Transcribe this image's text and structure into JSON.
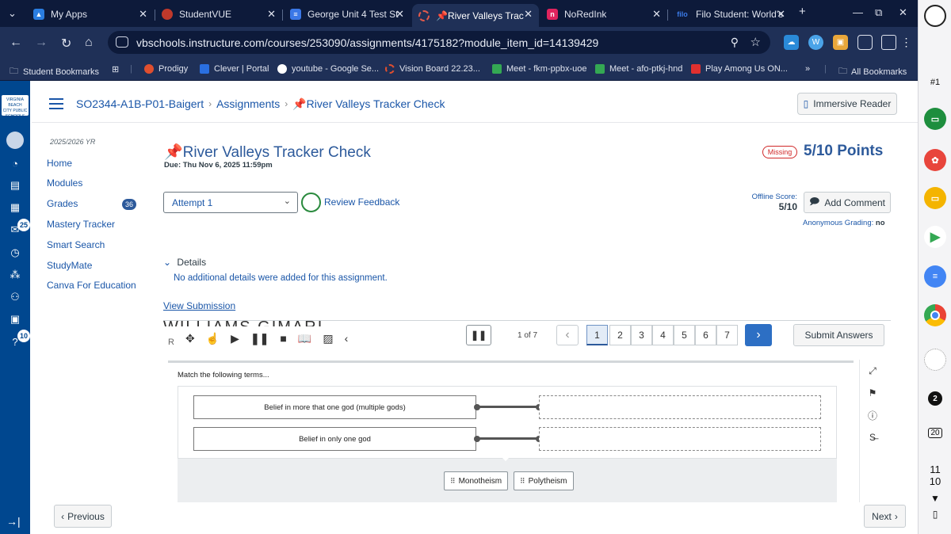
{
  "browser": {
    "tabs": [
      {
        "label": "My Apps",
        "fav_color": "#2a7de1"
      },
      {
        "label": "StudentVUE",
        "fav_color": "#c0392b"
      },
      {
        "label": "George Unit 4 Test St",
        "fav_color": "#3b78e7"
      },
      {
        "label": "📌River Valleys Trac",
        "fav_color": "#d44"
      },
      {
        "label": "NoRedInk",
        "fav_color": "#e0245e"
      },
      {
        "label": "Filo Student: World's",
        "fav_color": "#2f6fe0"
      }
    ],
    "new_tab": "+",
    "close": "✕",
    "url": "vbschools.instructure.com/courses/253090/assignments/4175182?module_item_id=14139429",
    "bookmarks": [
      {
        "label": "Student Bookmarks",
        "color": "#dfe3ee"
      },
      {
        "label": "Prodigy",
        "color": "#e04f2f"
      },
      {
        "label": "Clever | Portal",
        "color": "#2a6fe0"
      },
      {
        "label": "youtube - Google Se...",
        "color": "#ffffff"
      },
      {
        "label": "Vision Board 22.23...",
        "color": "#e04f2f"
      },
      {
        "label": "Meet - fkm-ppbx-uoe",
        "color": "#34a853"
      },
      {
        "label": "Meet - afo-ptkj-hnd",
        "color": "#34a853"
      },
      {
        "label": "Play Among Us ON...",
        "color": "#e0302f"
      },
      {
        "label": "»",
        "color": "#dfe3ee"
      },
      {
        "label": "All Bookmarks",
        "color": "#dfe3ee"
      }
    ]
  },
  "shelf": {
    "apps": [
      {
        "name": "chrome-icon",
        "color": "#4285f4"
      },
      {
        "name": "classroom-icon",
        "color": "#1e8e3e"
      },
      {
        "name": "art-icon",
        "color": "#e8453c"
      },
      {
        "name": "slides-icon",
        "color": "#f4b400"
      },
      {
        "name": "play-store-icon",
        "color": "#34a853"
      },
      {
        "name": "docs-icon",
        "color": "#4285f4"
      }
    ],
    "badge1": "#1",
    "notif_count": "2",
    "calendar_day": "20",
    "time_hour": "11",
    "time_min": "10"
  },
  "canvas": {
    "breadcrumb": {
      "course": "SO2344-A1B-P01-Baigert",
      "section": "Assignments",
      "current": "📌River Valleys Tracker Check"
    },
    "immersive_reader": "Immersive Reader",
    "term": "2025/2026 YR",
    "nav": [
      {
        "label": "Home"
      },
      {
        "label": "Modules"
      },
      {
        "label": "Grades",
        "count": "36"
      },
      {
        "label": "Mastery Tracker"
      },
      {
        "label": "Smart Search"
      },
      {
        "label": "StudyMate"
      },
      {
        "label": "Canva For Education"
      }
    ],
    "rail_badges": {
      "inbox": "25",
      "history": "10"
    }
  },
  "assignment": {
    "title": "📌River Valleys Tracker Check",
    "due": "Due: Thu Nov 6, 2025 11:59pm",
    "status": "Missing",
    "points": "5/10 Points",
    "attempt": "Attempt 1",
    "review_feedback": "Review Feedback",
    "offline_label": "Offline Score:",
    "offline_score": "5/10",
    "add_comment": "Add Comment",
    "anonymous_label": "Anonymous Grading:",
    "anonymous_value": "no",
    "details_label": "Details",
    "details_text": "No additional details were added for this assignment.",
    "view_submission": "View Submission",
    "previous": "Previous",
    "next": "Next"
  },
  "quiz": {
    "student_name": "WILLIAMS GIMARI",
    "row_letter": "R",
    "page_count": "1 of 7",
    "pages": [
      "1",
      "2",
      "3",
      "4",
      "5",
      "6",
      "7"
    ],
    "current_page": 1,
    "submit": "Submit Answers",
    "prompt": "Match the following terms...",
    "terms": [
      "Belief in more that one god (multiple gods)",
      "Belief in only one god"
    ],
    "answers": [
      "Monotheism",
      "Polytheism"
    ]
  }
}
